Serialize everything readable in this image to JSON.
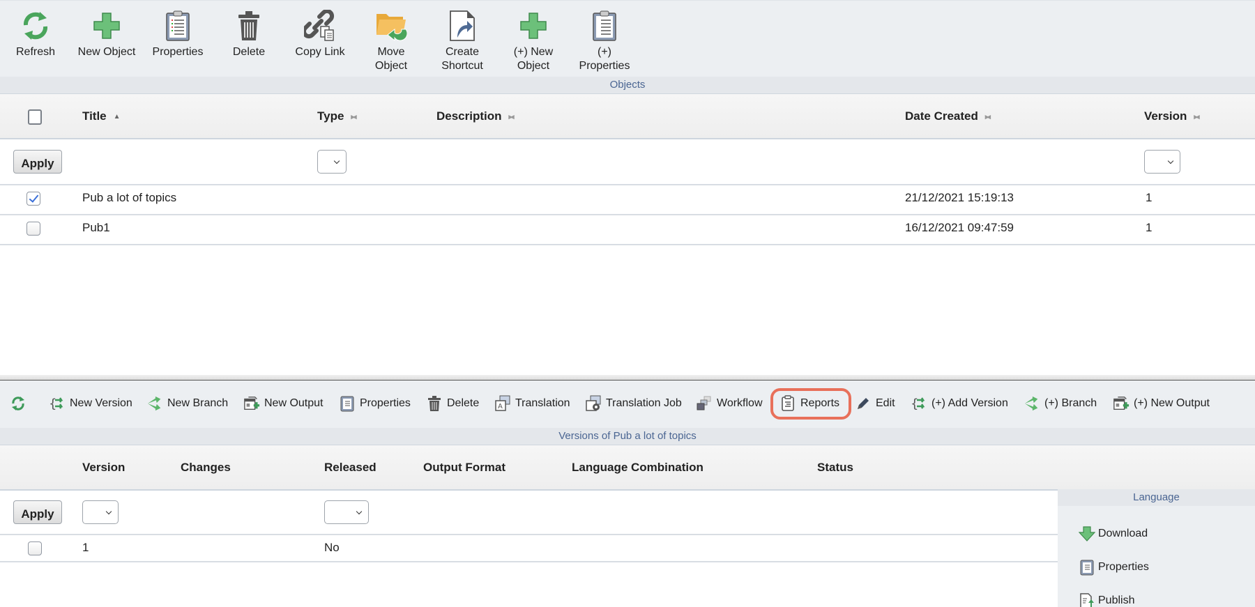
{
  "top_toolbar": {
    "buttons": [
      {
        "label": "Refresh",
        "icon": "refresh-icon"
      },
      {
        "label": "New Object",
        "icon": "plus-icon"
      },
      {
        "label": "Properties",
        "icon": "clipboard-icon"
      },
      {
        "label": "Delete",
        "icon": "trash-icon"
      },
      {
        "label": "Copy Link",
        "icon": "link-copy-icon"
      },
      {
        "label": "Move\nObject",
        "icon": "folder-move-icon"
      },
      {
        "label": "Create\nShortcut",
        "icon": "shortcut-icon"
      },
      {
        "label": "(+) New\nObject",
        "icon": "plus-icon"
      },
      {
        "label": "(+)\nProperties",
        "icon": "clipboard-icon"
      }
    ],
    "section_title": "Objects"
  },
  "objects_table": {
    "columns": [
      {
        "label": "Title",
        "sort": "asc"
      },
      {
        "label": "Type",
        "sort": "none"
      },
      {
        "label": "Description",
        "sort": "none"
      },
      {
        "label": "Date Created",
        "sort": "none"
      },
      {
        "label": "Version",
        "sort": "none"
      }
    ],
    "apply_label": "Apply",
    "type_filter_value": "",
    "version_filter_value": "",
    "rows": [
      {
        "checked": true,
        "title": "Pub a lot of topics",
        "type": "",
        "description": "",
        "date_created": "21/12/2021 15:19:13",
        "version": "1"
      },
      {
        "checked": false,
        "title": "Pub1",
        "type": "",
        "description": "",
        "date_created": "16/12/2021 09:47:59",
        "version": "1"
      }
    ]
  },
  "versions_toolbar": {
    "buttons": [
      {
        "label": "",
        "icon": "refresh-icon"
      },
      {
        "label": "New Version",
        "icon": "new-version-icon"
      },
      {
        "label": "New Branch",
        "icon": "branch-icon"
      },
      {
        "label": "New Output",
        "icon": "new-output-icon"
      },
      {
        "label": "Properties",
        "icon": "clipboard-icon"
      },
      {
        "label": "Delete",
        "icon": "trash-icon"
      },
      {
        "label": "Translation",
        "icon": "translation-icon"
      },
      {
        "label": "Translation Job",
        "icon": "translation-job-icon"
      },
      {
        "label": "Workflow",
        "icon": "workflow-icon"
      },
      {
        "label": "Reports",
        "icon": "reports-icon",
        "highlighted": true
      },
      {
        "label": "Edit",
        "icon": "pencil-icon"
      },
      {
        "label": "(+) Add Version",
        "icon": "new-version-icon"
      },
      {
        "label": "(+) Branch",
        "icon": "branch-icon"
      },
      {
        "label": "(+) New Output",
        "icon": "new-output-icon"
      }
    ],
    "section_title": "Versions of Pub a lot of topics",
    "highlight_color": "#e8705a"
  },
  "versions_table": {
    "columns": [
      "Version",
      "Changes",
      "Released",
      "Output Format",
      "Language Combination",
      "Status"
    ],
    "apply_label": "Apply",
    "version_filter_value": "",
    "released_filter_value": "",
    "rows": [
      {
        "checked": false,
        "version": "1",
        "changes": "",
        "released": "No",
        "output_format": "",
        "language_combination": "",
        "status": ""
      }
    ]
  },
  "language_panel": {
    "title": "Language",
    "items": [
      {
        "label": "Download",
        "icon": "download-icon"
      },
      {
        "label": "Properties",
        "icon": "clipboard-icon"
      },
      {
        "label": "Publish",
        "icon": "publish-icon"
      }
    ]
  },
  "colors": {
    "toolbar_bg": "#eceff2",
    "section_title": "#4a6592",
    "green_icon": "#5cb56a",
    "checkbox_check": "#3a6fd8"
  }
}
